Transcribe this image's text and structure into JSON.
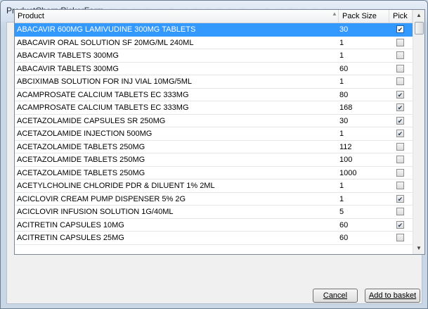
{
  "window": {
    "title": "ProductCherryPickerForm"
  },
  "grid": {
    "columns": {
      "product": "Product",
      "pack_size": "Pack Size",
      "pick": "Pick"
    },
    "rows": [
      {
        "product": "ABACAVIR 600MG LAMIVUDINE 300MG TABLETS",
        "pack": "30",
        "pick": true,
        "selected": true
      },
      {
        "product": "ABACAVIR ORAL SOLUTION SF 20MG/ML 240ML",
        "pack": "1",
        "pick": false
      },
      {
        "product": "ABACAVIR TABLETS 300MG",
        "pack": "1",
        "pick": false
      },
      {
        "product": "ABACAVIR TABLETS 300MG",
        "pack": "60",
        "pick": false
      },
      {
        "product": "ABCIXIMAB SOLUTION FOR INJ VIAL 10MG/5ML",
        "pack": "1",
        "pick": false
      },
      {
        "product": "ACAMPROSATE CALCIUM TABLETS EC 333MG",
        "pack": "80",
        "pick": true
      },
      {
        "product": "ACAMPROSATE CALCIUM TABLETS EC 333MG",
        "pack": "168",
        "pick": true
      },
      {
        "product": "ACETAZOLAMIDE CAPSULES SR 250MG",
        "pack": "30",
        "pick": true
      },
      {
        "product": "ACETAZOLAMIDE INJECTION 500MG",
        "pack": "1",
        "pick": true
      },
      {
        "product": "ACETAZOLAMIDE TABLETS 250MG",
        "pack": "112",
        "pick": false
      },
      {
        "product": "ACETAZOLAMIDE TABLETS 250MG",
        "pack": "100",
        "pick": false
      },
      {
        "product": "ACETAZOLAMIDE TABLETS 250MG",
        "pack": "1000",
        "pick": false
      },
      {
        "product": "ACETYLCHOLINE CHLORIDE PDR & DILUENT 1% 2ML",
        "pack": "1",
        "pick": false
      },
      {
        "product": "ACICLOVIR CREAM PUMP DISPENSER 5% 2G",
        "pack": "1",
        "pick": true
      },
      {
        "product": "ACICLOVIR INFUSION SOLUTION 1G/40ML",
        "pack": "5",
        "pick": false
      },
      {
        "product": "ACITRETIN CAPSULES 10MG",
        "pack": "60",
        "pick": true
      },
      {
        "product": "ACITRETIN CAPSULES 25MG",
        "pack": "60",
        "pick": false
      }
    ]
  },
  "buttons": {
    "cancel": "Cancel",
    "add_to_basket": "Add to basket"
  },
  "icons": {
    "sort": "sort-ascending-icon",
    "check": "checkmark-icon"
  }
}
